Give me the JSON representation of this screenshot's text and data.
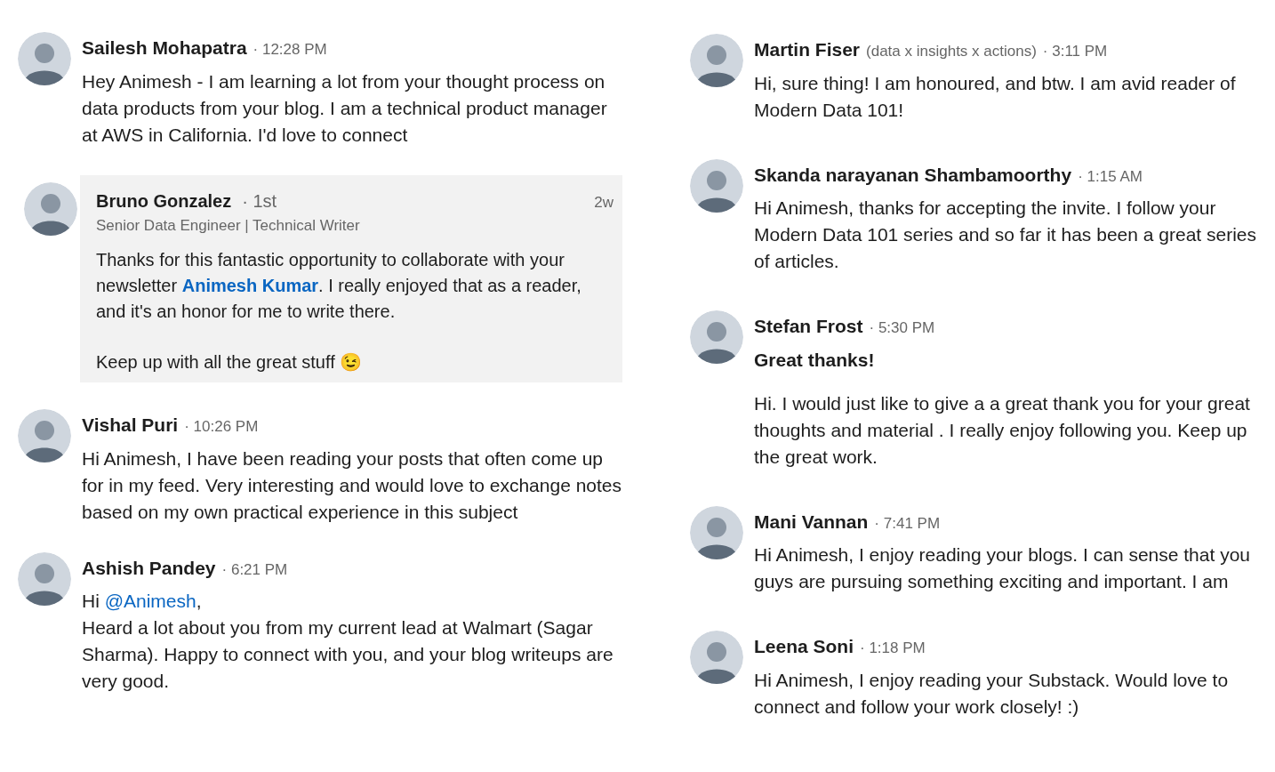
{
  "columns": [
    {
      "messages": [
        {
          "kind": "message",
          "name": "Sailesh Mohapatra",
          "time": "· 12:28 PM",
          "paragraphs": [
            {
              "kind": "body",
              "parts": [
                {
                  "kind": "text",
                  "text": "Hey Animesh - I am learning a lot from your thought process on data products from your blog. I am a technical product manager at AWS in California. I'd love to connect"
                }
              ]
            }
          ]
        },
        {
          "kind": "card",
          "name": "Bruno Gonzalez",
          "degree": "· 1st",
          "headline": "Senior Data Engineer | Technical Writer",
          "time": "2w",
          "paragraphs": [
            {
              "kind": "body",
              "parts": [
                {
                  "kind": "text",
                  "text": "Thanks for this fantastic opportunity to collaborate with your newsletter "
                },
                {
                  "kind": "link",
                  "text": "Animesh Kumar"
                },
                {
                  "kind": "text",
                  "text": ". I really enjoyed that as a reader, and it's an honor for me to write there."
                }
              ]
            },
            {
              "kind": "body",
              "parts": [
                {
                  "kind": "text",
                  "text": "Keep up with all the great stuff 😉"
                }
              ]
            }
          ]
        },
        {
          "kind": "message",
          "name": "Vishal Puri",
          "time": "· 10:26 PM",
          "paragraphs": [
            {
              "kind": "body",
              "parts": [
                {
                  "kind": "text",
                  "text": "Hi Animesh, I have been reading your posts that often come up for in my feed. Very interesting and would love to exchange notes based on my own practical experience in this subject"
                }
              ]
            }
          ]
        },
        {
          "kind": "message",
          "name": "Ashish Pandey",
          "time": "· 6:21 PM",
          "paragraphs": [
            {
              "kind": "body",
              "parts": [
                {
                  "kind": "text",
                  "text": "Hi "
                },
                {
                  "kind": "mention",
                  "text": "@Animesh"
                },
                {
                  "kind": "text",
                  "text": ","
                }
              ]
            },
            {
              "kind": "body",
              "parts": [
                {
                  "kind": "text",
                  "text": "Heard a lot about you from my current lead at Walmart (Sagar Sharma). Happy to connect with you, and your blog writeups are very good."
                }
              ]
            }
          ]
        }
      ]
    },
    {
      "messages": [
        {
          "kind": "message",
          "name": "Martin Fiser",
          "headline": "(data x insights x actions)",
          "time": "· 3:11 PM",
          "paragraphs": [
            {
              "kind": "body",
              "parts": [
                {
                  "kind": "text",
                  "text": "Hi, sure thing! I am honoured, and btw. I am avid reader of Modern Data 101!"
                }
              ]
            }
          ]
        },
        {
          "kind": "message",
          "name": "Skanda narayanan Shambamoorthy",
          "time": "· 1:15 AM",
          "paragraphs": [
            {
              "kind": "body",
              "parts": [
                {
                  "kind": "text",
                  "text": "Hi Animesh, thanks for accepting the invite. I follow your Modern Data 101 series and so far it has been a great series of articles."
                }
              ]
            }
          ]
        },
        {
          "kind": "message",
          "name": "Stefan Frost",
          "time": "· 5:30 PM",
          "paragraphs": [
            {
              "kind": "heading",
              "parts": [
                {
                  "kind": "text",
                  "text": "Great thanks!"
                }
              ]
            },
            {
              "kind": "body",
              "parts": [
                {
                  "kind": "text",
                  "text": "Hi. I would just like to give a a great thank you for your great thoughts and material . I really enjoy following you. Keep up the great work."
                }
              ]
            }
          ]
        },
        {
          "kind": "message",
          "name": "Mani Vannan",
          "time": "· 7:41 PM",
          "paragraphs": [
            {
              "kind": "body",
              "parts": [
                {
                  "kind": "text",
                  "text": "Hi Animesh, I enjoy reading your blogs. I can sense that you guys are pursuing something exciting and important. I am"
                }
              ]
            }
          ]
        },
        {
          "kind": "message",
          "name": "Leena Soni",
          "time": "· 1:18 PM",
          "paragraphs": [
            {
              "kind": "body",
              "parts": [
                {
                  "kind": "text",
                  "text": "Hi Animesh, I enjoy reading your Substack. Would love to connect and follow your work closely! :)"
                }
              ]
            }
          ]
        }
      ]
    }
  ]
}
